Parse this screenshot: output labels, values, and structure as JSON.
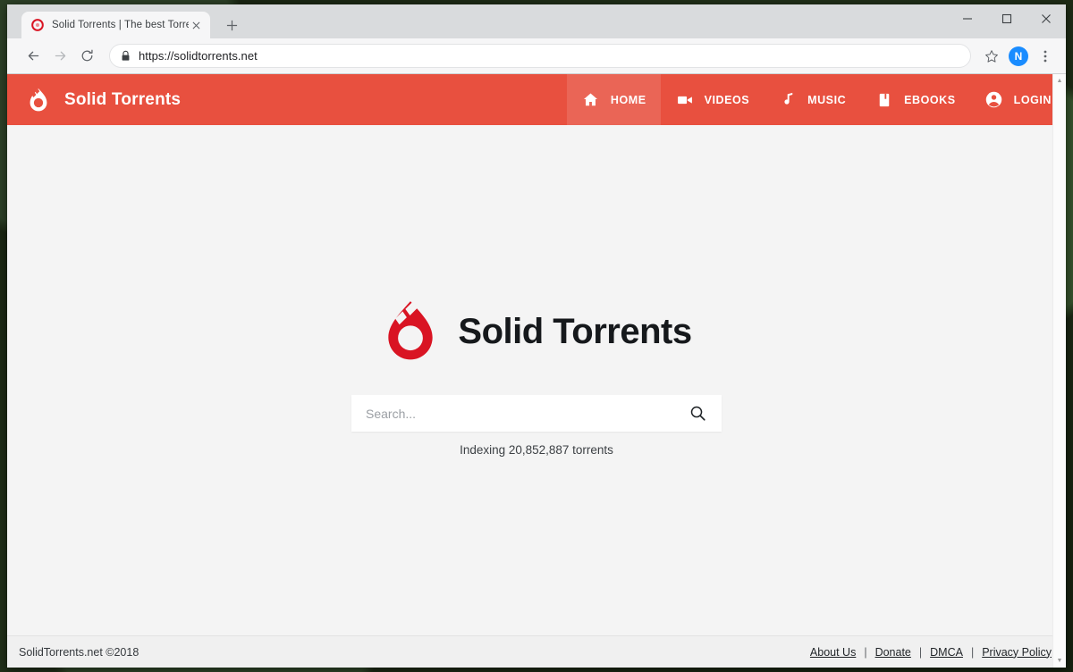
{
  "browser": {
    "tab": {
      "title": "Solid Torrents | The best Torrent",
      "favicon_icon": "solid-torrents-favicon",
      "close_icon": "close-icon"
    },
    "new_tab_icon": "plus-icon",
    "window_controls": {
      "minimize_icon": "minimize-icon",
      "maximize_icon": "maximize-icon",
      "close_icon": "close-icon"
    },
    "toolbar": {
      "back_icon": "back-arrow-icon",
      "forward_icon": "forward-arrow-icon",
      "reload_icon": "reload-icon",
      "lock_icon": "lock-icon",
      "url": "https://solidtorrents.net",
      "bookmark_icon": "star-icon",
      "profile_initial": "N",
      "menu_icon": "three-dot-menu-icon"
    }
  },
  "site": {
    "header": {
      "brand": "Solid Torrents",
      "brand_icon": "solid-torrents-logo",
      "accent_color": "#e8503f",
      "nav": [
        {
          "label": "HOME",
          "icon": "home-icon",
          "active": true
        },
        {
          "label": "VIDEOS",
          "icon": "video-icon",
          "active": false
        },
        {
          "label": "MUSIC",
          "icon": "music-icon",
          "active": false
        },
        {
          "label": "EBOOKS",
          "icon": "book-icon",
          "active": false
        },
        {
          "label": "LOGIN",
          "icon": "account-icon",
          "active": false
        }
      ]
    },
    "hero": {
      "logo_icon": "solid-torrents-logo-large",
      "logo_color": "#d91423",
      "wordmark": "Solid Torrents"
    },
    "search": {
      "value": "",
      "placeholder": "Search...",
      "button_icon": "search-icon"
    },
    "indexing_text": "Indexing 20,852,887 torrents",
    "footer": {
      "copyright": "SolidTorrents.net ©2018",
      "separator": "|",
      "links": [
        {
          "label": "About Us"
        },
        {
          "label": "Donate"
        },
        {
          "label": "DMCA"
        },
        {
          "label": "Privacy Policy"
        }
      ]
    }
  },
  "scrollbar": {
    "up_arrow_icon": "chevron-up-icon",
    "down_arrow_icon": "chevron-down-icon"
  }
}
